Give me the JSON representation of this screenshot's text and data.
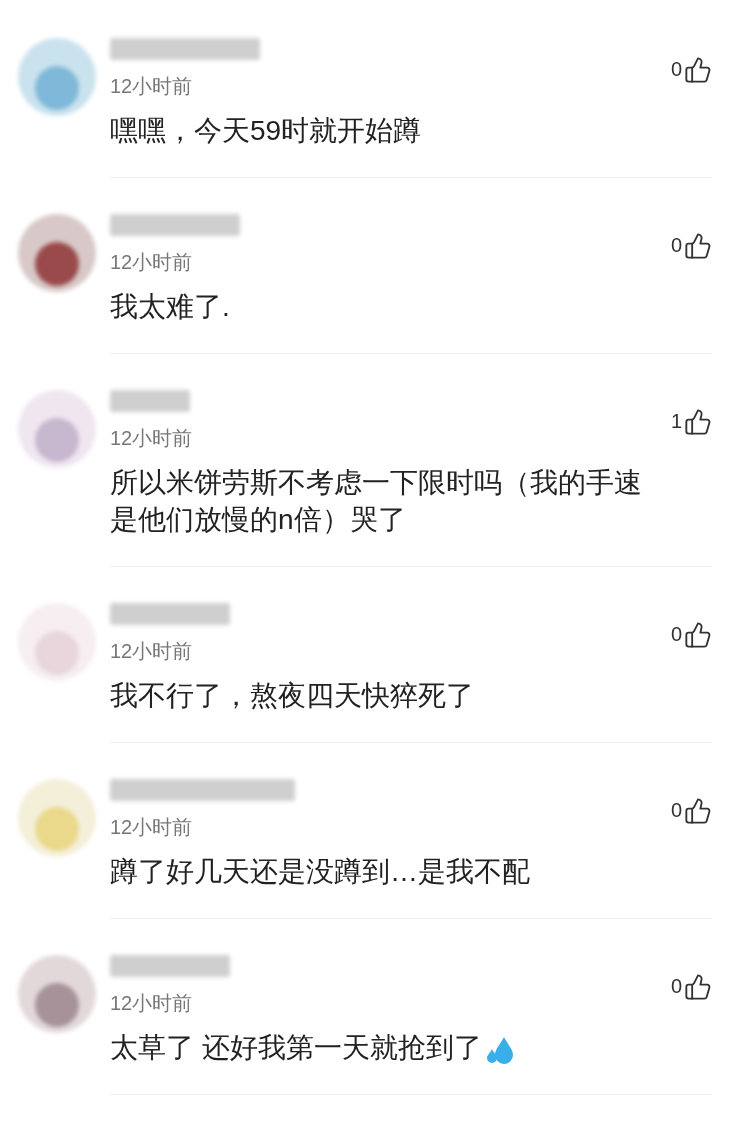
{
  "comments": [
    {
      "time": "12小时前",
      "text": "嘿嘿，今天59时就开始蹲",
      "likes": "0",
      "has_drop_icon": false
    },
    {
      "time": "12小时前",
      "text": "我太难了.",
      "likes": "0",
      "has_drop_icon": false
    },
    {
      "time": "12小时前",
      "text": "所以米饼劳斯不考虑一下限时吗（我的手速是他们放慢的n倍）哭了",
      "likes": "1",
      "has_drop_icon": false
    },
    {
      "time": "12小时前",
      "text": "我不行了，熬夜四天快猝死了",
      "likes": "0",
      "has_drop_icon": false
    },
    {
      "time": "12小时前",
      "text": "蹲了好几天还是没蹲到…是我不配",
      "likes": "0",
      "has_drop_icon": false
    },
    {
      "time": "12小时前",
      "text": "太草了 还好我第一天就抢到了",
      "likes": "0",
      "has_drop_icon": true
    }
  ]
}
